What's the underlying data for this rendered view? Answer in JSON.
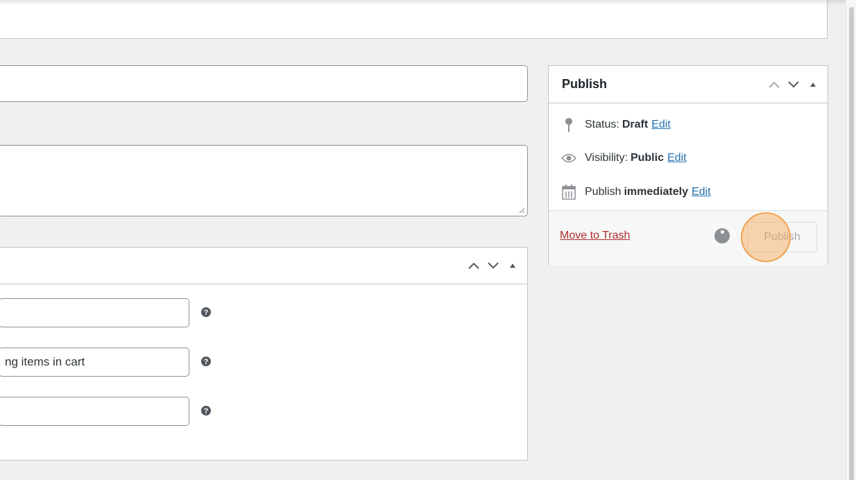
{
  "fields": [
    {
      "value": "",
      "help": "?"
    },
    {
      "value": "ng items in cart",
      "help": "?"
    },
    {
      "value": "",
      "help": "?"
    }
  ],
  "publish_box": {
    "title": "Publish",
    "status": {
      "label": "Status:",
      "value": "Draft",
      "edit": "Edit"
    },
    "visibility": {
      "label": "Visibility:",
      "value": "Public",
      "edit": "Edit"
    },
    "schedule": {
      "label": "Publish",
      "value": "immediately",
      "edit": "Edit"
    },
    "trash_label": "Move to Trash",
    "publish_label": "Publish"
  },
  "colors": {
    "link": "#2271b1",
    "trash": "#b32d2e",
    "highlight": "#f7a650"
  },
  "icons": {
    "status": "pin-icon",
    "visibility": "eye-icon",
    "schedule": "calendar-icon",
    "help": "help-icon",
    "collapse_up": "chevron-up-icon",
    "collapse_down": "chevron-down-icon",
    "toggle": "triangle-up-icon"
  }
}
